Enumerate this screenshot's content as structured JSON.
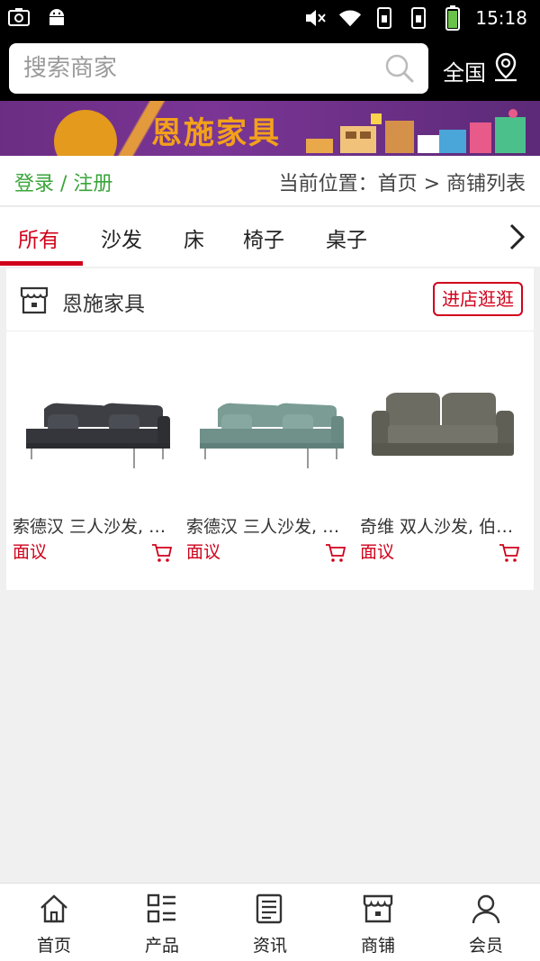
{
  "status_bar": {
    "time": "15:18",
    "icons": [
      "screenshot-icon",
      "android-icon",
      "mute-icon",
      "wifi-icon",
      "sim1-icon",
      "sim2-icon",
      "battery-icon"
    ]
  },
  "header": {
    "search_placeholder": "搜索商家",
    "region_label": "全国"
  },
  "banner": {
    "brand_text": "恩施家具"
  },
  "info_row": {
    "login_label": "登录",
    "separator": " / ",
    "register_label": "注册",
    "location_text": "当前位置：首页 > 商铺列表"
  },
  "tabs": [
    {
      "label": "所有",
      "active": true
    },
    {
      "label": "沙发",
      "active": false
    },
    {
      "label": "床",
      "active": false
    },
    {
      "label": "椅子",
      "active": false
    },
    {
      "label": "桌子",
      "active": false
    }
  ],
  "store": {
    "name": "恩施家具",
    "enter_label": "进店逛逛",
    "products": [
      {
        "title": "索德汉 三人沙发, …",
        "price": "面议",
        "color": "#3d3f44"
      },
      {
        "title": "索德汉 三人沙发, …",
        "price": "面议",
        "color": "#7a9c95"
      },
      {
        "title": "奇维 双人沙发, 伯…",
        "price": "面议",
        "color": "#6c6c62"
      }
    ]
  },
  "bottom_nav": [
    {
      "label": "首页",
      "icon": "home-icon"
    },
    {
      "label": "产品",
      "icon": "grid-list-icon"
    },
    {
      "label": "资讯",
      "icon": "news-icon"
    },
    {
      "label": "商铺",
      "icon": "store-icon"
    },
    {
      "label": "会员",
      "icon": "user-icon"
    }
  ],
  "colors": {
    "accent_red": "#d0021b",
    "login_green": "#3aa53a",
    "banner_purple": "#6b2d83"
  }
}
